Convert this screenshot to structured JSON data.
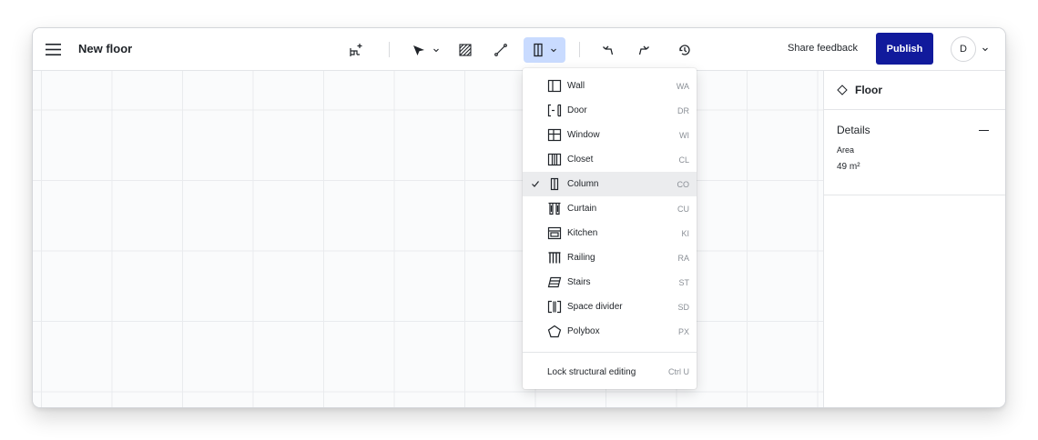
{
  "header": {
    "title": "New floor",
    "share_label": "Share feedback",
    "publish_label": "Publish",
    "avatar_initial": "D"
  },
  "toolbar": {
    "icons": [
      "add-furniture-icon",
      "pointer-icon",
      "chevron-down-icon",
      "hatch-area-icon",
      "measure-line-icon",
      "column-icon",
      "chevron-down-icon",
      "undo-icon",
      "redo-icon",
      "history-icon"
    ],
    "active_tool": "column"
  },
  "dropdown": {
    "items": [
      {
        "label": "Wall",
        "shortcut": "WA",
        "icon": "wall-icon",
        "selected": false
      },
      {
        "label": "Door",
        "shortcut": "DR",
        "icon": "door-icon",
        "selected": false
      },
      {
        "label": "Window",
        "shortcut": "WI",
        "icon": "window-icon",
        "selected": false
      },
      {
        "label": "Closet",
        "shortcut": "CL",
        "icon": "closet-icon",
        "selected": false
      },
      {
        "label": "Column",
        "shortcut": "CO",
        "icon": "column-icon",
        "selected": true
      },
      {
        "label": "Curtain",
        "shortcut": "CU",
        "icon": "curtain-icon",
        "selected": false
      },
      {
        "label": "Kitchen",
        "shortcut": "KI",
        "icon": "kitchen-icon",
        "selected": false
      },
      {
        "label": "Railing",
        "shortcut": "RA",
        "icon": "railing-icon",
        "selected": false
      },
      {
        "label": "Stairs",
        "shortcut": "ST",
        "icon": "stairs-icon",
        "selected": false
      },
      {
        "label": "Space divider",
        "shortcut": "SD",
        "icon": "space-divider-icon",
        "selected": false
      },
      {
        "label": "Polybox",
        "shortcut": "PX",
        "icon": "polybox-icon",
        "selected": false
      }
    ],
    "lock_label": "Lock structural editing",
    "lock_shortcut": "Ctrl U"
  },
  "panel": {
    "title": "Floor",
    "details_title": "Details",
    "area_label": "Area",
    "area_value": "49 m²"
  },
  "colors": {
    "publish_bg": "#111a9c",
    "active_tool_bg": "#c9dbff",
    "selected_item_bg": "#ebecee"
  }
}
